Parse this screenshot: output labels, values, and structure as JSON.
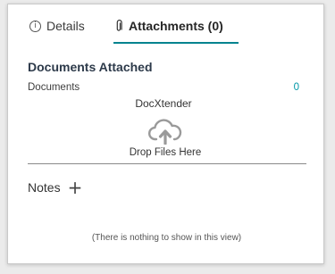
{
  "tabs": [
    {
      "label": "Details",
      "icon": "info-icon"
    },
    {
      "label": "Attachments (0)",
      "icon": "paperclip-icon"
    }
  ],
  "accent_color": "#00838f",
  "documents": {
    "title": "Documents Attached",
    "label": "Documents",
    "count": "0"
  },
  "dropzone": {
    "title": "DocXtender",
    "hint": "Drop Files Here",
    "icon": "cloud-upload-icon"
  },
  "notes": {
    "title": "Notes",
    "add_icon": "plus-icon",
    "add_symbol": "+",
    "empty_text": "(There is nothing to show in this view)"
  }
}
